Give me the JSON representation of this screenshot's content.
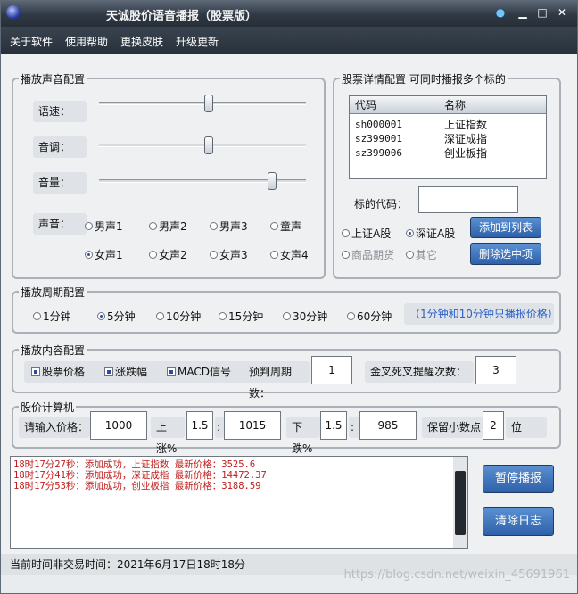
{
  "window": {
    "title": "天诚股价语音播报（股票版）"
  },
  "menu": [
    {
      "label": "关于软件"
    },
    {
      "label": "使用帮助"
    },
    {
      "label": "更换皮肤"
    },
    {
      "label": "升级更新"
    }
  ],
  "sound_config": {
    "title": "播放声音配置",
    "rate": {
      "label": "语速：",
      "value": 0.53
    },
    "pitch": {
      "label": "音调：",
      "value": 0.53
    },
    "volume": {
      "label": "音量：",
      "value": 0.85
    },
    "voice_label": "声音：",
    "voices": [
      "男声1",
      "男声2",
      "男声3",
      "童声",
      "女声1",
      "女声2",
      "女声3",
      "女声4"
    ],
    "selected_voice": "女声1"
  },
  "stock_config": {
    "title": "股票详情配置  可同时播报多个标的",
    "columns": [
      "代码",
      "名称"
    ],
    "rows": [
      {
        "code": "sh000001",
        "name": "上证指数"
      },
      {
        "code": "sz399001",
        "name": "深证成指"
      },
      {
        "code": "sz399006",
        "name": "创业板指"
      }
    ],
    "code_label": "标的代码：",
    "code_value": "",
    "markets": [
      "上证A股",
      "深证A股",
      "商品期货",
      "其它"
    ],
    "selected_market": "深证A股",
    "add_button": "添加到列表",
    "delete_button": "删除选中项"
  },
  "period_config": {
    "title": "播放周期配置",
    "options": [
      "1分钟",
      "5分钟",
      "10分钟",
      "15分钟",
      "30分钟",
      "60分钟"
    ],
    "selected": "5分钟",
    "hint": "（1分钟和10分钟只播报价格）"
  },
  "content_config": {
    "title": "播放内容配置",
    "items": [
      "股票价格",
      "涨跌幅",
      "MACD信号"
    ],
    "forecast_label": "预判周期数：",
    "forecast_value": "1",
    "cross_label": "金叉死叉提醒次数：",
    "cross_value": "3"
  },
  "calculator": {
    "title": "股价计算机",
    "price_label": "请输入价格：",
    "price_value": "1000",
    "up_label": "上涨%",
    "up_pct": "1.5",
    "up_result": "1015",
    "down_label": "下跌%",
    "down_pct": "1.5",
    "down_result": "985",
    "decimals_label": "保留小数点",
    "decimals_value": "2",
    "decimals_unit": "位"
  },
  "log": {
    "lines": [
      "18时17分27秒：添加成功，上证指数 最新价格：3525.6",
      "18时17分41秒：添加成功，深证成指 最新价格：14472.37",
      "18时17分53秒：添加成功，创业板指 最新价格：3188.59"
    ]
  },
  "actions": {
    "pause": "暂停播报",
    "clear": "清除日志"
  },
  "status": {
    "text": "当前时间非交易时间：2021年6月17日18时18分"
  },
  "watermark": "https://blog.csdn.net/weixin_45691961",
  "colors": {
    "accent": "#2e61aa",
    "log_text": "#c0201f",
    "hint": "#2c62c8"
  }
}
